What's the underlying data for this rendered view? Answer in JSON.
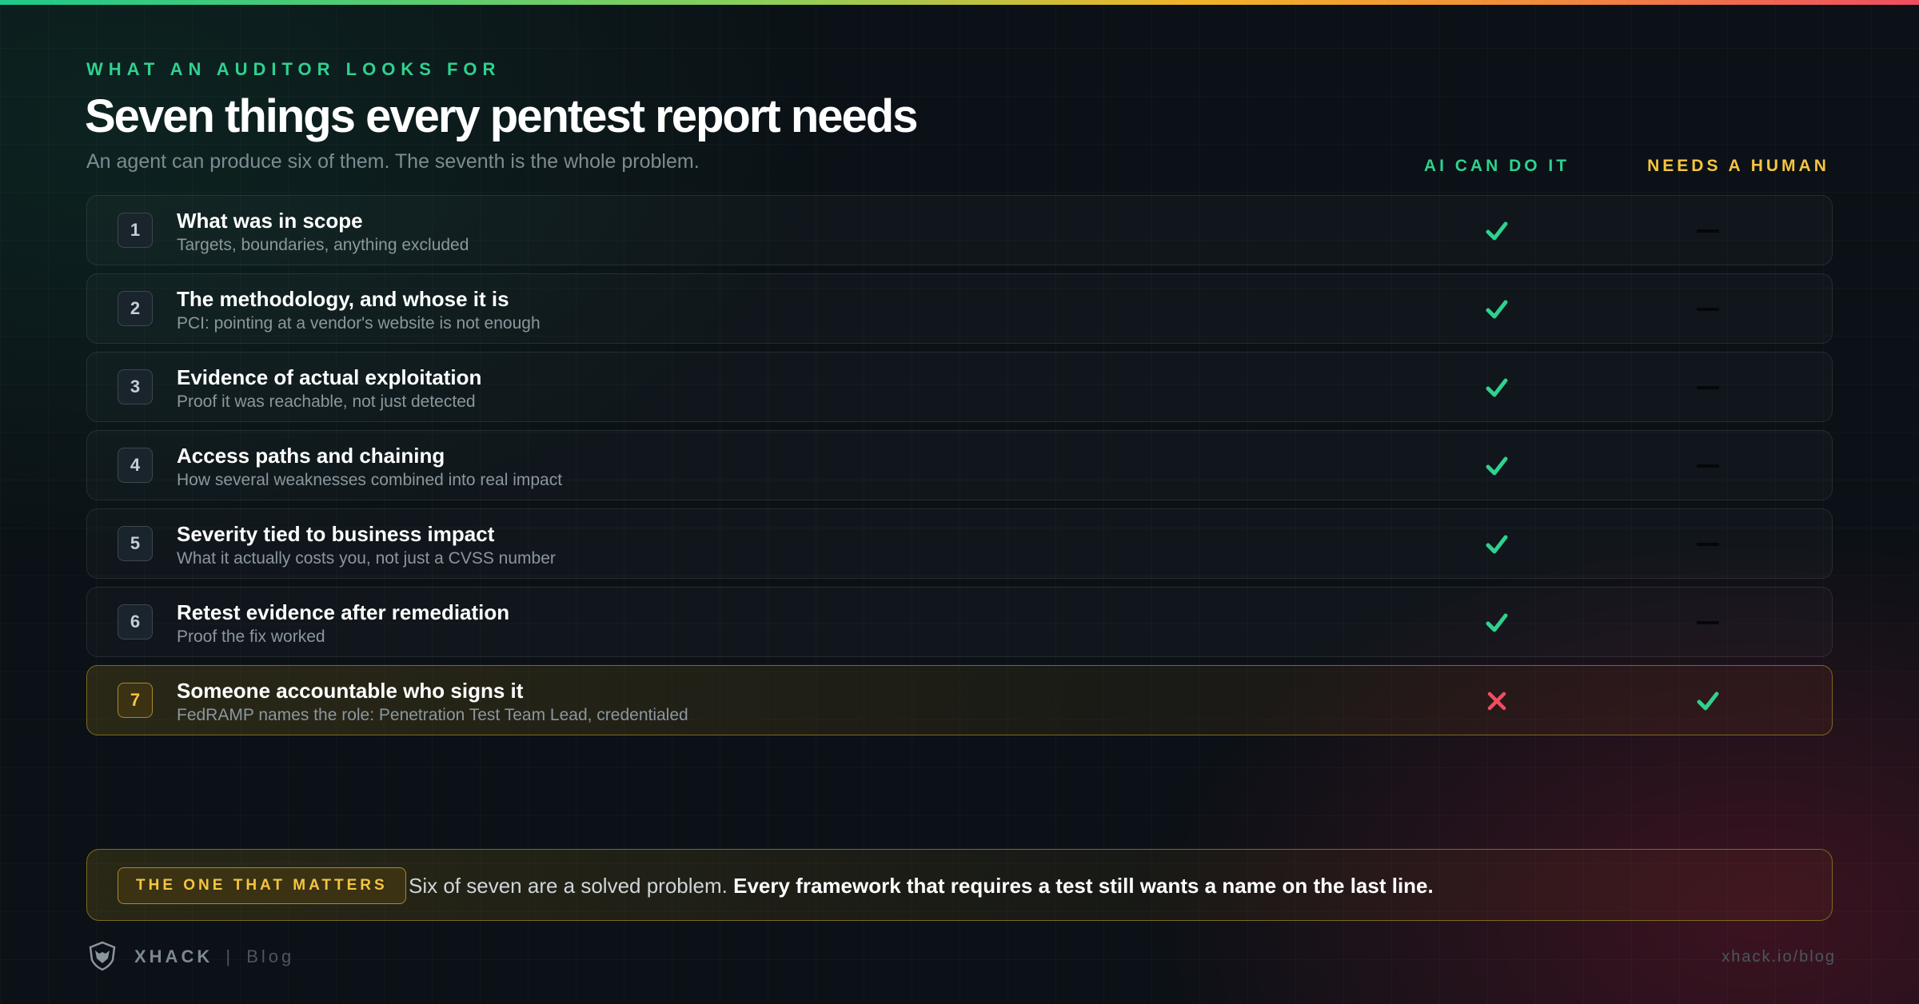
{
  "header": {
    "kicker": "WHAT AN AUDITOR LOOKS FOR",
    "title": "Seven things every pentest report needs",
    "subtitle": "An agent can produce six of them. The seventh is the whole problem."
  },
  "columns": {
    "ai": "AI CAN DO IT",
    "human": "NEEDS A HUMAN"
  },
  "items": [
    {
      "num": "1",
      "title": "What was in scope",
      "desc": "Targets, boundaries, anything excluded",
      "ai": "check",
      "human": "dash"
    },
    {
      "num": "2",
      "title": "The methodology, and whose it is",
      "desc": "PCI: pointing at a vendor's website is not enough",
      "ai": "check",
      "human": "dash"
    },
    {
      "num": "3",
      "title": "Evidence of actual exploitation",
      "desc": "Proof it was reachable, not just detected",
      "ai": "check",
      "human": "dash"
    },
    {
      "num": "4",
      "title": "Access paths and chaining",
      "desc": "How several weaknesses combined into real impact",
      "ai": "check",
      "human": "dash"
    },
    {
      "num": "5",
      "title": "Severity tied to business impact",
      "desc": "What it actually costs you, not just a CVSS number",
      "ai": "check",
      "human": "dash"
    },
    {
      "num": "6",
      "title": "Retest evidence after remediation",
      "desc": "Proof the fix worked",
      "ai": "check",
      "human": "dash"
    },
    {
      "num": "7",
      "title": "Someone accountable who signs it",
      "desc": "FedRAMP names the role: Penetration Test Team Lead, credentialed",
      "ai": "cross",
      "human": "check"
    }
  ],
  "callout": {
    "badge": "THE ONE THAT MATTERS",
    "text": "Six of seven are a solved problem.",
    "emphasis": "Every framework that requires a test still wants a name on the last line."
  },
  "footer": {
    "brand": "XHACK",
    "separator": "|",
    "section": "Blog",
    "url": "xhack.io/blog"
  },
  "colors": {
    "accent_green": "#2fd18f",
    "accent_yellow": "#f5c542",
    "accent_red": "#ef4d62",
    "background": "#0b1116"
  }
}
